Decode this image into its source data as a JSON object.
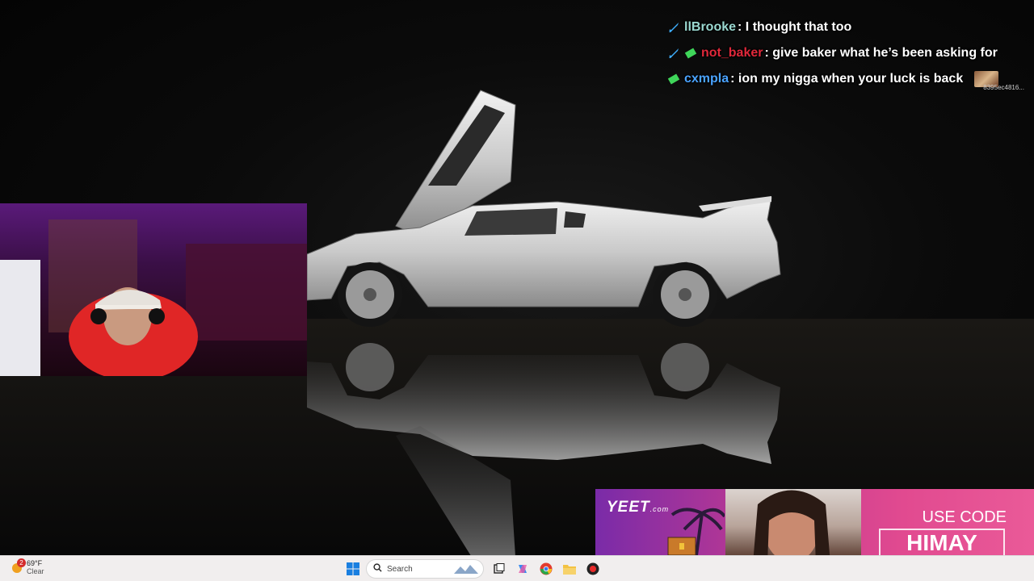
{
  "chat": {
    "messages": [
      {
        "username": "llBrooke",
        "username_color": "#9ad8d0",
        "badges": [
          "sword-badge"
        ],
        "text": "I thought that too"
      },
      {
        "username": "not_baker",
        "username_color": "#e0283a",
        "badges": [
          "sword-badge",
          "money-badge"
        ],
        "text": "give baker what he’s been asking for"
      },
      {
        "username": "cxmpla",
        "username_color": "#4aa3ff",
        "badges": [
          "money-badge"
        ],
        "text": "ion my nigga when your luck is back",
        "emote": "8395ec4816..."
      }
    ]
  },
  "ad": {
    "brand": "YEET",
    "brand_suffix": ".com",
    "use_code_label": "USE CODE",
    "code": "HIMAY"
  },
  "taskbar": {
    "weather_temp": "69°F",
    "weather_condition": "Clear",
    "notification_count": "2",
    "search_placeholder": "Search",
    "pinned_icons": [
      "windows-start-icon",
      "task-view-icon",
      "copilot-icon",
      "chrome-icon",
      "file-explorer-icon",
      "obs-icon"
    ]
  },
  "colors": {
    "taskbar_bg": "#f1eeee",
    "ad_pink": "#e14a90",
    "ad_purple": "#7a2ba8"
  }
}
